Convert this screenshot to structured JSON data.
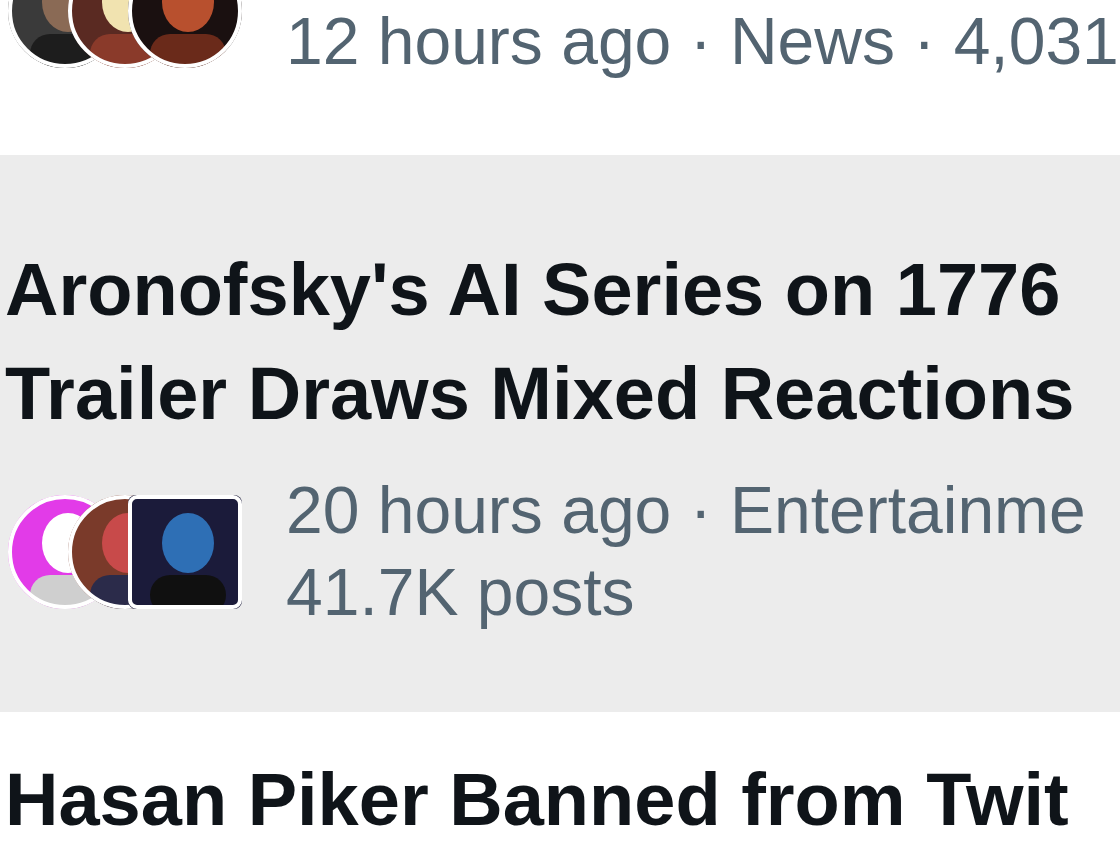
{
  "trends": [
    {
      "highlighted": false,
      "avatars": [
        {
          "kind": "picture"
        },
        {
          "kind": "picture"
        },
        {
          "kind": "picture"
        }
      ],
      "meta": [
        "12 hours ago · News · 4,031"
      ]
    },
    {
      "highlighted": true,
      "title": "Aronofsky's AI Series on 1776 Trailer Draws Mixed Reactions",
      "avatars": [
        {
          "kind": "picture"
        },
        {
          "kind": "picture"
        },
        {
          "kind": "picture"
        }
      ],
      "meta": [
        "20 hours ago · Entertainme",
        "41.7K posts"
      ]
    },
    {
      "highlighted": false,
      "title": "Hasan Piker Banned from Twit"
    }
  ]
}
